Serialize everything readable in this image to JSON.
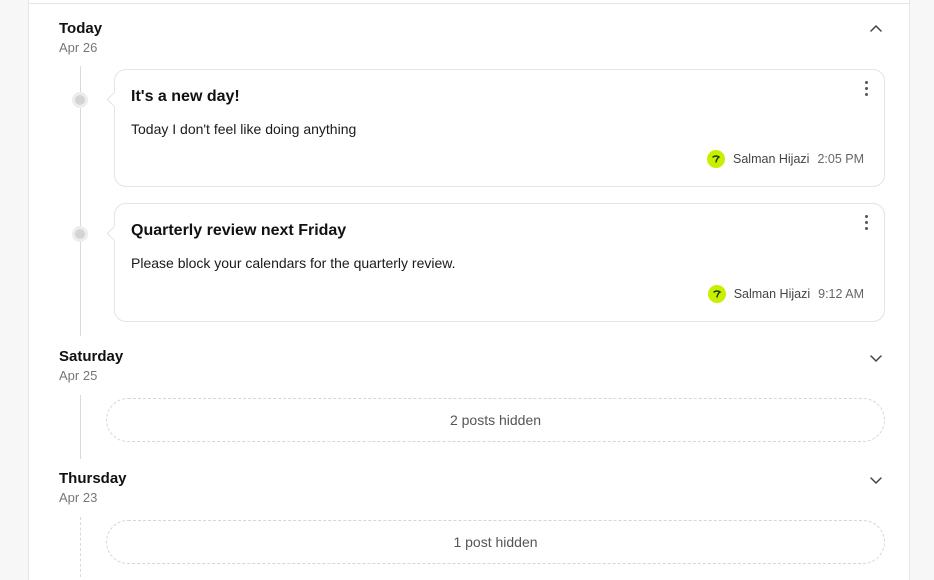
{
  "days": [
    {
      "title": "Today",
      "date": "Apr 26",
      "expanded": true,
      "posts": [
        {
          "title": "It's a new day!",
          "body": "Today I don't feel like doing anything",
          "author": "Salman Hijazi",
          "time": "2:05 PM"
        },
        {
          "title": "Quarterly review next Friday",
          "body": "Please block your calendars for the quarterly review.",
          "author": "Salman Hijazi",
          "time": "9:12 AM"
        }
      ]
    },
    {
      "title": "Saturday",
      "date": "Apr 25",
      "expanded": false,
      "hidden_label": "2 posts hidden"
    },
    {
      "title": "Thursday",
      "date": "Apr 23",
      "expanded": false,
      "hidden_label": "1 post hidden"
    }
  ],
  "colors": {
    "avatar_bg": "#c7f000",
    "timeline": "#dadada"
  },
  "icons": {
    "collapse": "chevron-up-icon",
    "expand": "chevron-down-icon",
    "more": "kebab-menu-icon",
    "avatar": "leaf-avatar-icon"
  }
}
